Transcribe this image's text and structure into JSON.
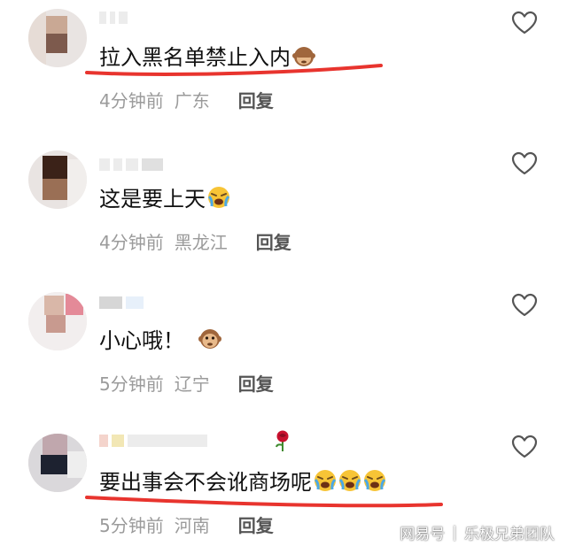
{
  "comments": [
    {
      "text": "拉入黑名单禁止入内",
      "emojis": [
        "see-no-evil-monkey"
      ],
      "time": "4分钟前",
      "region": "广东",
      "reply": "回复",
      "underlined": true
    },
    {
      "text": "这是要上天",
      "emojis": [
        "crying-face"
      ],
      "time": "4分钟前",
      "region": "黑龙江",
      "reply": "回复",
      "underlined": false
    },
    {
      "text": "小心哦！",
      "emojis": [
        "monkey-face"
      ],
      "time": "5分钟前",
      "region": "辽宁",
      "reply": "回复",
      "underlined": false
    },
    {
      "text": "要出事会不会讹商场呢",
      "emojis": [
        "crying-face",
        "crying-face",
        "crying-face"
      ],
      "time": "5分钟前",
      "region": "河南",
      "reply": "回复",
      "underlined": true
    }
  ],
  "watermark": {
    "source": "网易号",
    "separator": "|",
    "author": "乐极兄弟团队"
  },
  "colors": {
    "underline": "#e8342e",
    "meta": "#9b9b9b",
    "text": "#111111",
    "heart": "#555555"
  },
  "icons": {
    "like": "heart-outline-icon"
  }
}
